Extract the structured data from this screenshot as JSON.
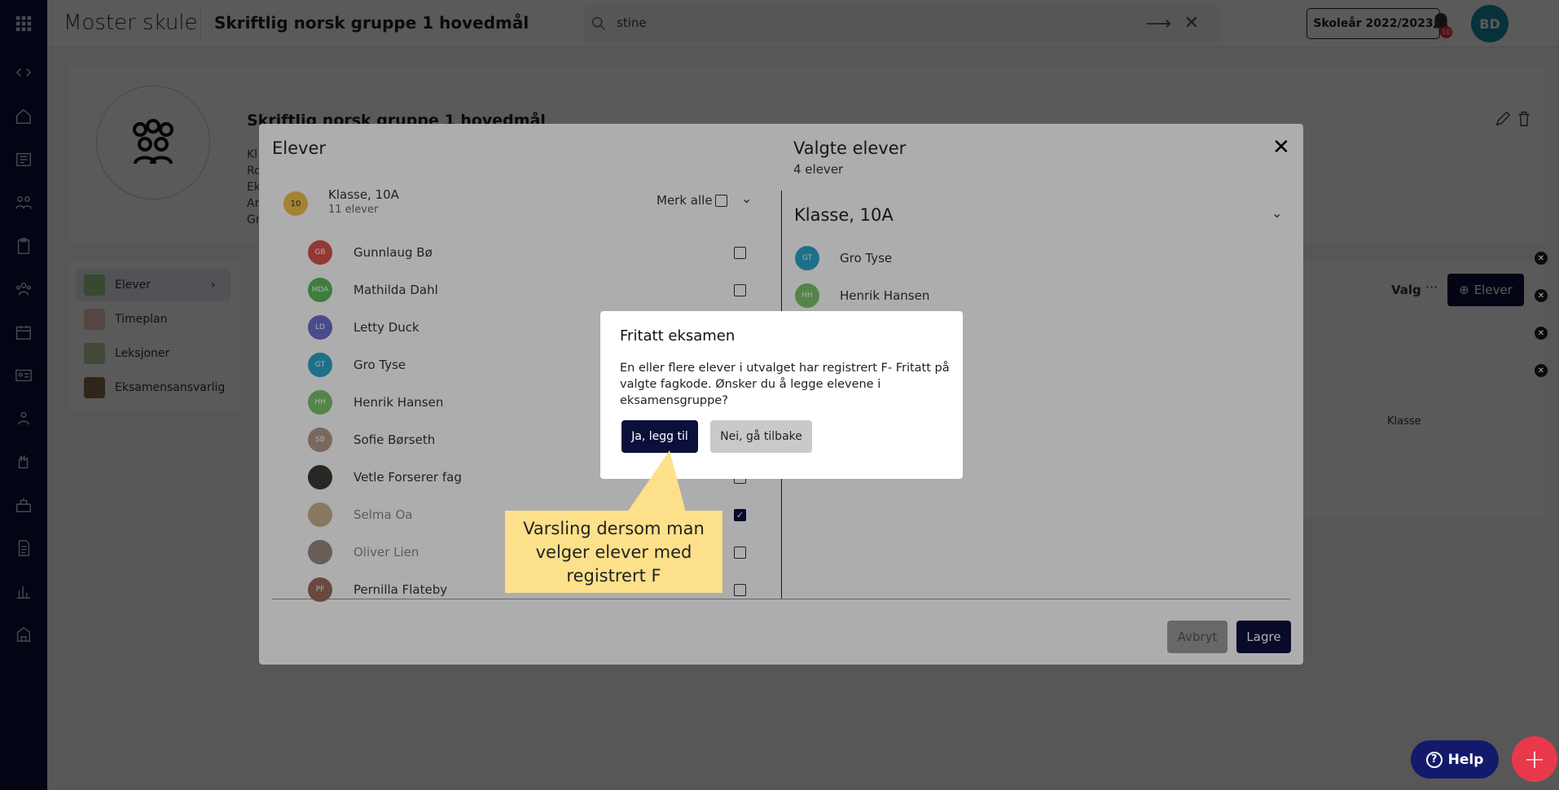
{
  "topbar": {
    "school": "Moster skule",
    "course_title": "Skriftlig norsk gruppe 1 hovedmål",
    "search_value": "stine",
    "year_button": "Skoleår 2022/2023",
    "notification_count": "10",
    "user_initials": "BD"
  },
  "background": {
    "group_title": "Skriftlig norsk gruppe 1 hovedmål",
    "meta_lines": [
      "Kl",
      "Ro",
      "Ek",
      "Ar",
      "Gr"
    ],
    "menu": [
      "Elever",
      "Timeplan",
      "Leksjoner",
      "Eksamensansvarlig"
    ],
    "right": {
      "valg": "Valg",
      "add_button": "Elever",
      "column": "Klasse"
    }
  },
  "modal": {
    "left_title": "Elever",
    "right_title": "Valgte elever",
    "right_count": "4 elever",
    "class_chip": "10",
    "class_name": "Klasse, 10A",
    "class_count": "11 elever",
    "select_all": "Merk alle",
    "students": [
      {
        "initials": "GB",
        "name": "Gunnlaug Bø",
        "color": "#d9534f",
        "checked": false,
        "dim": false
      },
      {
        "initials": "MDA",
        "name": "Mathilda Dahl",
        "color": "#5cb85c",
        "checked": false,
        "dim": false
      },
      {
        "initials": "LD",
        "name": "Letty Duck",
        "color": "#6a6fd0",
        "checked": false,
        "dim": false
      },
      {
        "initials": "GT",
        "name": "Gro Tyse",
        "color": "#2aa7c9",
        "checked": false,
        "dim": false
      },
      {
        "initials": "HH",
        "name": "Henrik Hansen",
        "color": "#7cc36b",
        "checked": false,
        "dim": false
      },
      {
        "initials": "SB",
        "name": "Sofie Børseth",
        "color": "#b59a8a",
        "checked": false,
        "dim": false
      },
      {
        "initials": "",
        "name": "Vetle Forserer fag",
        "color": "#3d3a35",
        "checked": false,
        "dim": false
      },
      {
        "initials": "",
        "name": "Selma Oa",
        "color": "#c9b28f",
        "checked": true,
        "dim": true
      },
      {
        "initials": "",
        "name": "Oliver Lien",
        "color": "#9a8a80",
        "checked": false,
        "dim": true
      },
      {
        "initials": "PF",
        "name": "Pernilla Flateby",
        "color": "#9b6b5a",
        "checked": false,
        "dim": false
      }
    ],
    "selected_class": "Klasse, 10A",
    "selected": [
      {
        "initials": "GT",
        "name": "Gro Tyse",
        "color": "#2aa7c9"
      },
      {
        "initials": "HH",
        "name": "Henrik Hansen",
        "color": "#7cc36b"
      },
      {
        "initials": "",
        "name": "",
        "color": ""
      },
      {
        "initials": "",
        "name": "",
        "color": ""
      }
    ],
    "cancel": "Avbryt",
    "save": "Lagre"
  },
  "dialog": {
    "title": "Fritatt eksamen",
    "body": "En eller flere elever i utvalget har registrert F- Fritatt på valgte fagkode. Ønsker du å legge elevene i eksamensgruppe?",
    "yes": "Ja, legg til",
    "no": "Nei, gå tilbake"
  },
  "callout": {
    "text": "Varsling dersom man velger elever med registrert F"
  },
  "help_label": "Help",
  "icons": [
    "apps-grid-icon",
    "code-toggle-icon",
    "home-icon",
    "news-icon",
    "groups-icon",
    "clipboard-icon",
    "people-icon",
    "calendar-icon",
    "id-card-icon",
    "teacher-icon",
    "hand-icon",
    "school-icon",
    "document-icon",
    "bar-chart-icon",
    "building-icon"
  ]
}
